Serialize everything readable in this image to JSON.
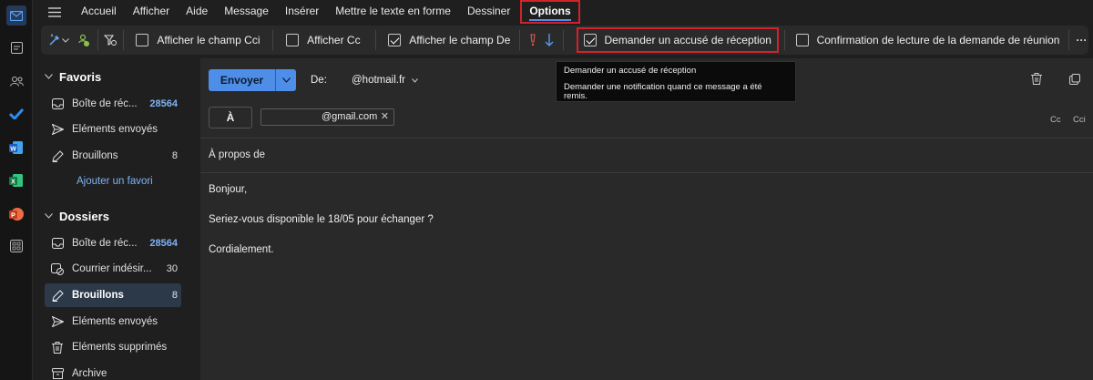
{
  "menu": {
    "items": [
      "Accueil",
      "Afficher",
      "Aide",
      "Message",
      "Insérer",
      "Mettre le texte en forme",
      "Dessiner"
    ],
    "active": "Options"
  },
  "ribbon": {
    "show_bcc": "Afficher le champ Cci",
    "show_cc": "Afficher Cc",
    "show_from": "Afficher le champ De",
    "read_receipt": "Demander un accusé de réception",
    "meeting_read_confirm": "Confirmation de lecture de la demande de réunion",
    "more": "···"
  },
  "tooltip": {
    "title": "Demander un accusé de réception",
    "description": "Demander une notification quand ce message a été remis."
  },
  "folders": {
    "favorites_title": "Favoris",
    "favorites": [
      {
        "label": "Boîte de réc...",
        "count": "28564"
      },
      {
        "label": "Éléments envoyés",
        "count": ""
      },
      {
        "label": "Brouillons",
        "count": "8"
      }
    ],
    "add_favorite": "Ajouter un favori",
    "folders_title": "Dossiers",
    "folders": [
      {
        "label": "Boîte de réc...",
        "count": "28564"
      },
      {
        "label": "Courrier indésir...",
        "count": "30"
      },
      {
        "label": "Brouillons",
        "count": "8"
      },
      {
        "label": "Éléments envoyés",
        "count": ""
      },
      {
        "label": "Éléments supprimés",
        "count": ""
      },
      {
        "label": "Archive",
        "count": ""
      }
    ]
  },
  "compose": {
    "send_label": "Envoyer",
    "from_label": "De:",
    "from_value": "@hotmail.fr",
    "to_label": "À",
    "recipient": "@gmail.com",
    "cc_label": "Cc",
    "bcc_label": "Cci",
    "subject_placeholder": "À propos de",
    "body_lines": [
      "Bonjour,",
      "Seriez-vous disponible le 18/05 pour échanger ?",
      "Cordialement."
    ]
  },
  "colors": {
    "accent": "#4f8ee8",
    "highlight_border": "#d1232a"
  }
}
